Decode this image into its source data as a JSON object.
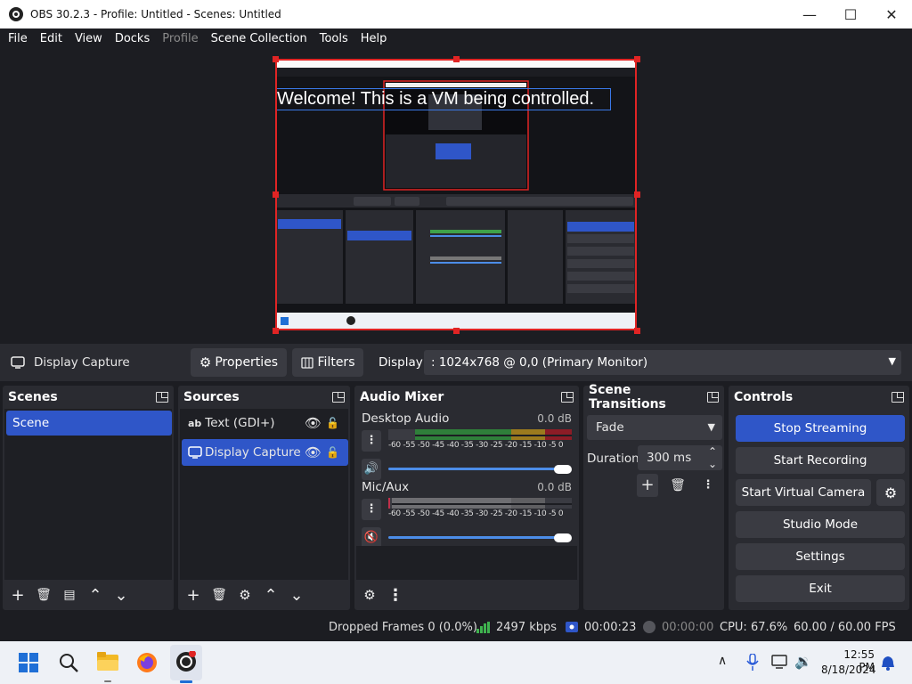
{
  "window": {
    "title": "OBS 30.2.3 - Profile: Untitled - Scenes: Untitled",
    "minimize": "—",
    "maximize": "☐",
    "close": "✕"
  },
  "menu": [
    "File",
    "Edit",
    "View",
    "Docks",
    "Profile",
    "Scene Collection",
    "Tools",
    "Help"
  ],
  "preview": {
    "overlay_text": "Welcome! This is a VM being controlled."
  },
  "source_bar": {
    "current_source": "Display Capture",
    "properties": "Properties",
    "filters": "Filters",
    "display_label": "Display",
    "display_value": ": 1024x768 @ 0,0 (Primary Monitor)"
  },
  "scenes": {
    "title": "Scenes",
    "items": [
      "Scene"
    ]
  },
  "sources": {
    "title": "Sources",
    "items": [
      {
        "name": "Text (GDI+)",
        "icon": "text-icon"
      },
      {
        "name": "Display Capture",
        "icon": "monitor-icon"
      }
    ]
  },
  "audio_mixer": {
    "title": "Audio Mixer",
    "channels": [
      {
        "name": "Desktop Audio",
        "level": "0.0 dB",
        "scale": "-60 -55 -50 -45 -40 -35 -30 -25 -20 -15 -10 -5 0",
        "muted": false
      },
      {
        "name": "Mic/Aux",
        "level": "0.0 dB",
        "scale": "-60 -55 -50 -45 -40 -35 -30 -25 -20 -15 -10 -5 0",
        "muted": true
      }
    ]
  },
  "scene_transitions": {
    "title": "Scene Transitions",
    "transition": "Fade",
    "duration_label": "Duration",
    "duration_value": "300 ms"
  },
  "controls": {
    "title": "Controls",
    "buttons": [
      "Stop Streaming",
      "Start Recording",
      "Start Virtual Camera",
      "Studio Mode",
      "Settings",
      "Exit"
    ]
  },
  "status": {
    "dropped_frames": "Dropped Frames 0 (0.0%)",
    "bitrate": "2497 kbps",
    "stream_time": "00:00:23",
    "rec_time": "00:00:00",
    "cpu": "CPU: 67.6%",
    "fps": "60.00 / 60.00 FPS"
  },
  "taskbar": {
    "time": "12:55 PM",
    "date": "8/18/2024"
  },
  "colors": {
    "accent": "#2f56c8",
    "red": "#e02424",
    "panel": "#2a2b31",
    "bg": "#1c1d22"
  }
}
